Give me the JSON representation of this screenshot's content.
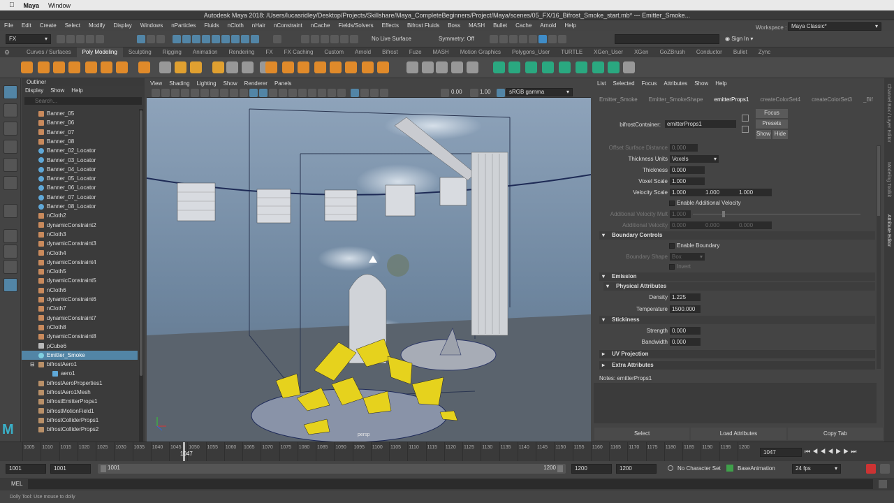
{
  "mac": {
    "app": "Maya",
    "menu": [
      "Window"
    ]
  },
  "window_title": "Autodesk Maya 2018: /Users/lucasridley/Desktop/Projects/Skillshare/Maya_CompleteBeginners/Project/Maya/scenes/05_FX/16_Bifrost_Smoke_start.mb*  ---  Emitter_Smoke...",
  "menus": [
    "File",
    "Edit",
    "Create",
    "Select",
    "Modify",
    "Display",
    "Windows",
    "nParticles",
    "Fluids",
    "nCloth",
    "nHair",
    "nConstraint",
    "nCache",
    "Fields/Solvers",
    "Effects",
    "Bifrost Fluids",
    "Boss",
    "MASH",
    "Bullet",
    "Cache",
    "Arnold",
    "Help"
  ],
  "status": {
    "menuset": "FX",
    "live_surface": "No Live Surface",
    "symmetry": "Symmetry: Off",
    "sign_in": "Sign In",
    "workspace_label": "Workspace :",
    "workspace": "Maya Classic*"
  },
  "shelf_tabs": [
    "Curves / Surfaces",
    "Poly Modeling",
    "Sculpting",
    "Rigging",
    "Animation",
    "Rendering",
    "FX",
    "FX Caching",
    "Custom",
    "Arnold",
    "Bifrost",
    "Fuze",
    "MASH",
    "Motion Graphics",
    "Polygons_User",
    "TURTLE",
    "XGen_User",
    "XGen",
    "GoZBrush",
    "Conductor",
    "Bullet",
    "Zync"
  ],
  "shelf_active": "Poly Modeling",
  "outliner": {
    "title": "Outliner",
    "menu": [
      "Display",
      "Show",
      "Help"
    ],
    "search_placeholder": "Search...",
    "items": [
      {
        "label": "Banner_05",
        "type": "cloth"
      },
      {
        "label": "Banner_06",
        "type": "cloth"
      },
      {
        "label": "Banner_07",
        "type": "cloth"
      },
      {
        "label": "Banner_08",
        "type": "cloth"
      },
      {
        "label": "Banner_02_Locator",
        "type": "locator"
      },
      {
        "label": "Banner_03_Locator",
        "type": "locator"
      },
      {
        "label": "Banner_04_Locator",
        "type": "locator"
      },
      {
        "label": "Banner_05_Locator",
        "type": "locator"
      },
      {
        "label": "Banner_06_Locator",
        "type": "locator"
      },
      {
        "label": "Banner_07_Locator",
        "type": "locator"
      },
      {
        "label": "Banner_08_Locator",
        "type": "locator"
      },
      {
        "label": "nCloth2",
        "type": "ncloth"
      },
      {
        "label": "dynamicConstraint2",
        "type": "constraint"
      },
      {
        "label": "nCloth3",
        "type": "ncloth"
      },
      {
        "label": "dynamicConstraint3",
        "type": "constraint"
      },
      {
        "label": "nCloth4",
        "type": "ncloth"
      },
      {
        "label": "dynamicConstraint4",
        "type": "constraint"
      },
      {
        "label": "nCloth5",
        "type": "ncloth"
      },
      {
        "label": "dynamicConstraint5",
        "type": "constraint"
      },
      {
        "label": "nCloth6",
        "type": "ncloth"
      },
      {
        "label": "dynamicConstraint6",
        "type": "constraint"
      },
      {
        "label": "nCloth7",
        "type": "ncloth"
      },
      {
        "label": "dynamicConstraint7",
        "type": "constraint"
      },
      {
        "label": "nCloth8",
        "type": "ncloth"
      },
      {
        "label": "dynamicConstraint8",
        "type": "constraint"
      },
      {
        "label": "pCube6",
        "type": "mesh"
      },
      {
        "label": "Emitter_Smoke",
        "type": "emitter",
        "selected": true
      },
      {
        "label": "bifrostAero1",
        "type": "bifrost",
        "expand": true
      },
      {
        "label": "aero1",
        "type": "aero",
        "indent": true
      },
      {
        "label": "bifrostAeroProperties1",
        "type": "bifrost"
      },
      {
        "label": "bifrostAero1Mesh",
        "type": "bifrost"
      },
      {
        "label": "bifrostEmitterProps1",
        "type": "bifrost"
      },
      {
        "label": "bifrostMotionField1",
        "type": "bifrost"
      },
      {
        "label": "bifrostColliderProps1",
        "type": "bifrost"
      },
      {
        "label": "bifrostColliderProps2",
        "type": "bifrost"
      }
    ]
  },
  "viewport": {
    "menu": [
      "View",
      "Shading",
      "Lighting",
      "Show",
      "Renderer",
      "Panels"
    ],
    "near": "0.00",
    "far": "1.00",
    "color_space": "sRGB gamma",
    "camera_label": "persp"
  },
  "attr": {
    "menu": [
      "List",
      "Selected",
      "Focus",
      "Attributes",
      "Show",
      "Help"
    ],
    "tabs": [
      "Emitter_Smoke",
      "Emitter_SmokeShape",
      "emitterProps1",
      "createColorSet4",
      "createColorSet3",
      "_Bif"
    ],
    "active_tab": "emitterProps1",
    "container_label": "bifrostContainer:",
    "container_value": "emitterProps1",
    "focus": "Focus",
    "presets": "Presets",
    "show": "Show",
    "hide": "Hide",
    "offset_label": "Offset Surface Distance",
    "offset_value": "0.000",
    "thickness_units_label": "Thickness Units",
    "thickness_units": "Voxels",
    "thickness_label": "Thickness",
    "thickness": "0.000",
    "voxel_scale_label": "Voxel Scale",
    "voxel_scale": "1.000",
    "velocity_scale_label": "Velocity Scale",
    "velocity_scale": [
      "1.000",
      "1.000",
      "1.000"
    ],
    "enable_add_vel": "Enable Additional Velocity",
    "add_vel_mult_label": "Additional Velocity Mult",
    "add_vel_mult": "1.000",
    "add_vel_label": "Additional Velocity",
    "add_vel": [
      "0.000",
      "0.000",
      "0.000"
    ],
    "boundary_controls": "Boundary Controls",
    "enable_boundary": "Enable Boundary",
    "boundary_shape_label": "Boundary Shape",
    "boundary_shape": "Box",
    "invert": "Invert",
    "emission": "Emission",
    "physical": "Physical Attributes",
    "density_label": "Density",
    "density": "1.225",
    "temperature_label": "Temperature",
    "temperature": "1500.000",
    "stickiness": "Stickiness",
    "strength_label": "Strength",
    "strength": "0.000",
    "bandwidth_label": "Bandwidth",
    "bandwidth": "0.000",
    "uv_projection": "UV Projection",
    "extra_attributes": "Extra Attributes",
    "notes": "Notes:  emitterProps1",
    "bottom": [
      "Select",
      "Load Attributes",
      "Copy Tab"
    ]
  },
  "right_strip": [
    "Channel Box / Layer Editor",
    "Modeling Toolkit",
    "Attribute Editor"
  ],
  "timeline": {
    "ticks": [
      "1005",
      "1010",
      "1015",
      "1020",
      "1025",
      "1030",
      "1035",
      "1040",
      "1045",
      "1050",
      "1055",
      "1060",
      "1065",
      "1070",
      "1075",
      "1080",
      "1085",
      "1090",
      "1095",
      "1100",
      "1105",
      "1110",
      "1115",
      "1120",
      "1125",
      "1130",
      "1135",
      "1140",
      "1145",
      "1150",
      "1155",
      "1160",
      "1165",
      "1170",
      "1175",
      "1180",
      "1185",
      "1190",
      "1195",
      "1200"
    ],
    "current_frame_label": "1047",
    "current_frame_field": "1047"
  },
  "range": {
    "start_a": "1001",
    "start_b": "1001",
    "range_start": "1001",
    "range_end": "1200",
    "end_a": "1200",
    "end_b": "1200",
    "character": "No Character Set",
    "anim_layer": "BaseAnimation",
    "fps": "24 fps"
  },
  "cmd_label": "MEL",
  "help_text": "Dolly Tool: Use mouse to dolly",
  "colors": {
    "accent": "#5285a6",
    "cloth": "#c98a5c",
    "locator": "#5fa8d8",
    "bifrost": "#b99068",
    "yellow_shards": "#e6d21d"
  }
}
